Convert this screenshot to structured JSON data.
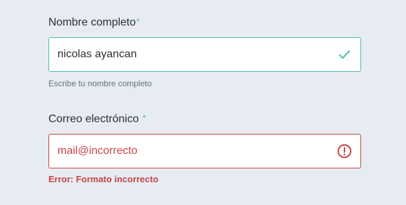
{
  "form": {
    "name_field": {
      "label": "Nombre completo",
      "required_mark": "*",
      "value": "nicolas ayancan",
      "hint": "Escribe tu nombre completo",
      "status_icon": "checkmark-icon",
      "border_color": "#49bfb0"
    },
    "email_field": {
      "label": "Correo electrónico",
      "required_mark": "*",
      "value": "mail@incorrecto",
      "error": "Error: Formato incorrecto",
      "status_icon": "error-circle-icon",
      "border_color": "#c84545"
    }
  }
}
